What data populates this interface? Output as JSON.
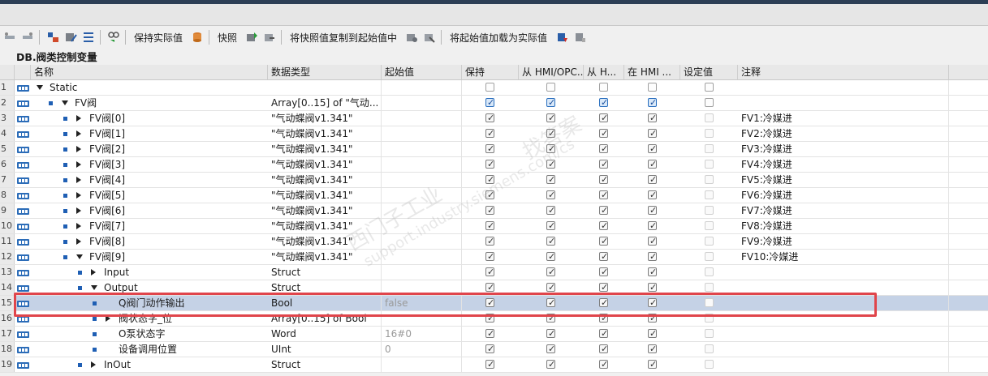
{
  "toolbar": {
    "keep_actual": "保持实际值",
    "snapshot": "快照",
    "copy_snapshot": "将快照值复制到起始值中",
    "load_start": "将起始值加载为实际值"
  },
  "db_title": "DB.阀类控制变量",
  "columns": {
    "name": "名称",
    "datatype": "数据类型",
    "start": "起始值",
    "retain": "保持",
    "from_hmi_opc": "从 HMI/OPC...",
    "from_h": "从 H...",
    "in_hmi": "在 HMI ...",
    "setpoint": "设定值",
    "comment": "注释"
  },
  "rows": [
    {
      "n": "1",
      "indent": 0,
      "dot": false,
      "arrow": "down",
      "name": "Static",
      "type": "",
      "start": "",
      "cbs": [
        "empty",
        "empty",
        "empty",
        "empty",
        "empty"
      ],
      "comment": ""
    },
    {
      "n": "2",
      "indent": 1,
      "dot": true,
      "arrow": "down",
      "name": "FV阀",
      "type": "Array[0..15] of \"气动...",
      "start": "",
      "cbs": [
        "blue",
        "blue",
        "blue",
        "blue",
        "empty"
      ],
      "comment": ""
    },
    {
      "n": "3",
      "indent": 2,
      "dot": true,
      "arrow": "right",
      "name": "FV阀[0]",
      "type": "\"气动蝶阀v1.341\"",
      "start": "",
      "cbs": [
        "on",
        "on",
        "on",
        "on",
        "dim"
      ],
      "comment": "FV1:冷媒进"
    },
    {
      "n": "4",
      "indent": 2,
      "dot": true,
      "arrow": "right",
      "name": "FV阀[1]",
      "type": "\"气动蝶阀v1.341\"",
      "start": "",
      "cbs": [
        "on",
        "on",
        "on",
        "on",
        "dim"
      ],
      "comment": "FV2:冷媒进"
    },
    {
      "n": "5",
      "indent": 2,
      "dot": true,
      "arrow": "right",
      "name": "FV阀[2]",
      "type": "\"气动蝶阀v1.341\"",
      "start": "",
      "cbs": [
        "on",
        "on",
        "on",
        "on",
        "dim"
      ],
      "comment": "FV3:冷媒进"
    },
    {
      "n": "6",
      "indent": 2,
      "dot": true,
      "arrow": "right",
      "name": "FV阀[3]",
      "type": "\"气动蝶阀v1.341\"",
      "start": "",
      "cbs": [
        "on",
        "on",
        "on",
        "on",
        "dim"
      ],
      "comment": "FV4:冷媒进"
    },
    {
      "n": "7",
      "indent": 2,
      "dot": true,
      "arrow": "right",
      "name": "FV阀[4]",
      "type": "\"气动蝶阀v1.341\"",
      "start": "",
      "cbs": [
        "on",
        "on",
        "on",
        "on",
        "dim"
      ],
      "comment": "FV5:冷媒进"
    },
    {
      "n": "8",
      "indent": 2,
      "dot": true,
      "arrow": "right",
      "name": "FV阀[5]",
      "type": "\"气动蝶阀v1.341\"",
      "start": "",
      "cbs": [
        "on",
        "on",
        "on",
        "on",
        "dim"
      ],
      "comment": "FV6:冷媒进"
    },
    {
      "n": "9",
      "indent": 2,
      "dot": true,
      "arrow": "right",
      "name": "FV阀[6]",
      "type": "\"气动蝶阀v1.341\"",
      "start": "",
      "cbs": [
        "on",
        "on",
        "on",
        "on",
        "dim"
      ],
      "comment": "FV7:冷媒进"
    },
    {
      "n": "10",
      "indent": 2,
      "dot": true,
      "arrow": "right",
      "name": "FV阀[7]",
      "type": "\"气动蝶阀v1.341\"",
      "start": "",
      "cbs": [
        "on",
        "on",
        "on",
        "on",
        "dim"
      ],
      "comment": "FV8:冷媒进"
    },
    {
      "n": "11",
      "indent": 2,
      "dot": true,
      "arrow": "right",
      "name": "FV阀[8]",
      "type": "\"气动蝶阀v1.341\"",
      "start": "",
      "cbs": [
        "on",
        "on",
        "on",
        "on",
        "dim"
      ],
      "comment": "FV9:冷媒进"
    },
    {
      "n": "12",
      "indent": 2,
      "dot": true,
      "arrow": "down",
      "name": "FV阀[9]",
      "type": "\"气动蝶阀v1.341\"",
      "start": "",
      "cbs": [
        "on",
        "on",
        "on",
        "on",
        "dim"
      ],
      "comment": "FV10:冷媒进"
    },
    {
      "n": "13",
      "indent": 3,
      "dot": true,
      "arrow": "right",
      "name": "Input",
      "type": "Struct",
      "start": "",
      "cbs": [
        "on",
        "on",
        "on",
        "on",
        "dim"
      ],
      "comment": ""
    },
    {
      "n": "14",
      "indent": 3,
      "dot": true,
      "arrow": "down",
      "name": "Output",
      "type": "Struct",
      "start": "",
      "cbs": [
        "on",
        "on",
        "on",
        "on",
        "dim"
      ],
      "comment": ""
    },
    {
      "n": "15",
      "indent": 4,
      "dot": true,
      "arrow": "",
      "name": "Q阀门动作输出",
      "type": "Bool",
      "start": "false",
      "cbs": [
        "on",
        "on",
        "on",
        "on",
        "dim"
      ],
      "comment": "",
      "selected": true
    },
    {
      "n": "16",
      "indent": 4,
      "dot": true,
      "arrow": "right",
      "name": "阀状态字_位",
      "type": "Array[0..15] of Bool",
      "start": "",
      "cbs": [
        "on",
        "on",
        "on",
        "on",
        "dim"
      ],
      "comment": ""
    },
    {
      "n": "17",
      "indent": 4,
      "dot": true,
      "arrow": "",
      "name": "O泵状态字",
      "type": "Word",
      "start": "16#0",
      "cbs": [
        "on",
        "on",
        "on",
        "on",
        "dim"
      ],
      "comment": ""
    },
    {
      "n": "18",
      "indent": 4,
      "dot": true,
      "arrow": "",
      "name": "设备调用位置",
      "type": "UInt",
      "start": "0",
      "cbs": [
        "on",
        "on",
        "on",
        "on",
        "dim"
      ],
      "comment": ""
    },
    {
      "n": "19",
      "indent": 3,
      "dot": true,
      "arrow": "right",
      "name": "InOut",
      "type": "Struct",
      "start": "",
      "cbs": [
        "on",
        "on",
        "on",
        "on",
        "dim"
      ],
      "comment": ""
    }
  ],
  "watermark": {
    "line1": "西门子工业",
    "line2": "support.industry.siemens.com/cs",
    "line3": "找答案"
  }
}
